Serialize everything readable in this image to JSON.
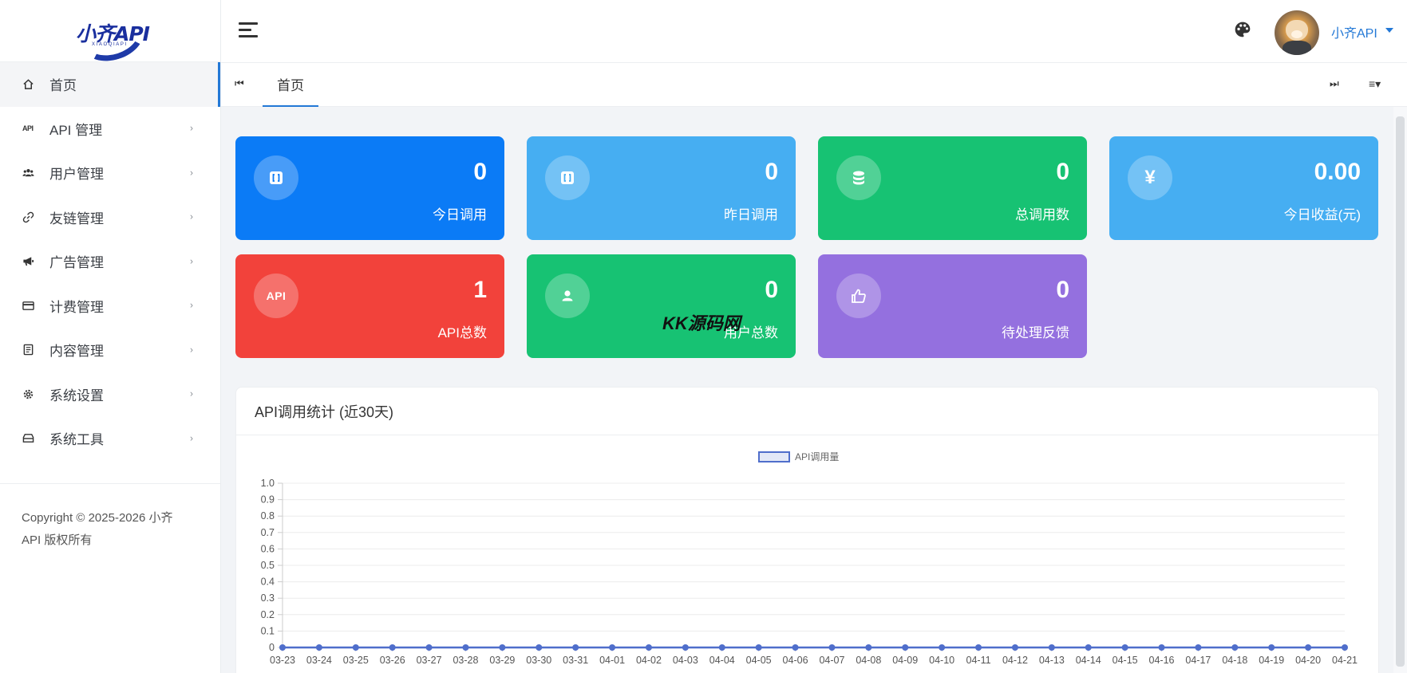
{
  "brand": {
    "logo_text": "小齐API",
    "logo_subtext": "XIAOQIAPI",
    "brand_color": "#1a2f9e"
  },
  "sidebar": {
    "items": [
      {
        "label": "首页",
        "icon": "home-icon",
        "active": true
      },
      {
        "label": "API 管理",
        "icon": "api-icon",
        "chevron": "›"
      },
      {
        "label": "用户管理",
        "icon": "users-icon",
        "chevron": "›"
      },
      {
        "label": "友链管理",
        "icon": "link-icon",
        "chevron": "›"
      },
      {
        "label": "广告管理",
        "icon": "megaphone-icon",
        "chevron": "›"
      },
      {
        "label": "计费管理",
        "icon": "credit-card-icon",
        "chevron": "›"
      },
      {
        "label": "内容管理",
        "icon": "document-icon",
        "chevron": "›"
      },
      {
        "label": "系统设置",
        "icon": "gear-icon",
        "chevron": "›"
      },
      {
        "label": "系统工具",
        "icon": "toolbox-icon",
        "chevron": "›"
      }
    ],
    "copyright_line1": "Copyright © 2025-2026 小齐",
    "copyright_line2": "API 版权所有"
  },
  "header": {
    "user_name": "小齐API",
    "accent_color": "#2378d6"
  },
  "tabs": {
    "prev": "⏮",
    "home": "首页",
    "next": "⏭",
    "menu": "≡▾"
  },
  "cards": [
    {
      "value": "0",
      "label": "今日调用",
      "color": "#0b7bf6",
      "icon": "brackets-icon"
    },
    {
      "value": "0",
      "label": "昨日调用",
      "color": "#46aef2",
      "icon": "brackets-icon"
    },
    {
      "value": "0",
      "label": "总调用数",
      "color": "#17c273",
      "icon": "database-icon"
    },
    {
      "value": "0.00",
      "label": "今日收益(元)",
      "color": "#46aef2",
      "icon": "yen-icon",
      "icon_glyph": "¥"
    },
    {
      "value": "1",
      "label": "API总数",
      "color": "#f2423b",
      "icon": "api-badge-icon",
      "icon_glyph": "API"
    },
    {
      "value": "0",
      "label": "用户总数",
      "color": "#17c273",
      "icon": "user-icon"
    },
    {
      "value": "0",
      "label": "待处理反馈",
      "color": "#9470df",
      "icon": "thumbs-up-icon"
    }
  ],
  "watermark": "KK源码网",
  "chart_panel": {
    "title": "API调用统计 (近30天)"
  },
  "chart_data": {
    "type": "line",
    "title": "",
    "xlabel": "",
    "ylabel": "",
    "legend": "top-center",
    "grid": true,
    "ylim": [
      0,
      1
    ],
    "yticks": [
      "1.0",
      "0.9",
      "0.8",
      "0.7",
      "0.6",
      "0.5",
      "0.4",
      "0.3",
      "0.2",
      "0.1",
      "0"
    ],
    "x": [
      "03-23",
      "03-24",
      "03-25",
      "03-26",
      "03-27",
      "03-28",
      "03-29",
      "03-30",
      "03-31",
      "04-01",
      "04-02",
      "04-03",
      "04-04",
      "04-05",
      "04-06",
      "04-07",
      "04-08",
      "04-09",
      "04-10",
      "04-11",
      "04-12",
      "04-13",
      "04-14",
      "04-15",
      "04-16",
      "04-17",
      "04-18",
      "04-19",
      "04-20",
      "04-21"
    ],
    "series": [
      {
        "name": "API调用量",
        "color": "#4f6ecb",
        "values": [
          0,
          0,
          0,
          0,
          0,
          0,
          0,
          0,
          0,
          0,
          0,
          0,
          0,
          0,
          0,
          0,
          0,
          0,
          0,
          0,
          0,
          0,
          0,
          0,
          0,
          0,
          0,
          0,
          0,
          0
        ]
      }
    ]
  }
}
